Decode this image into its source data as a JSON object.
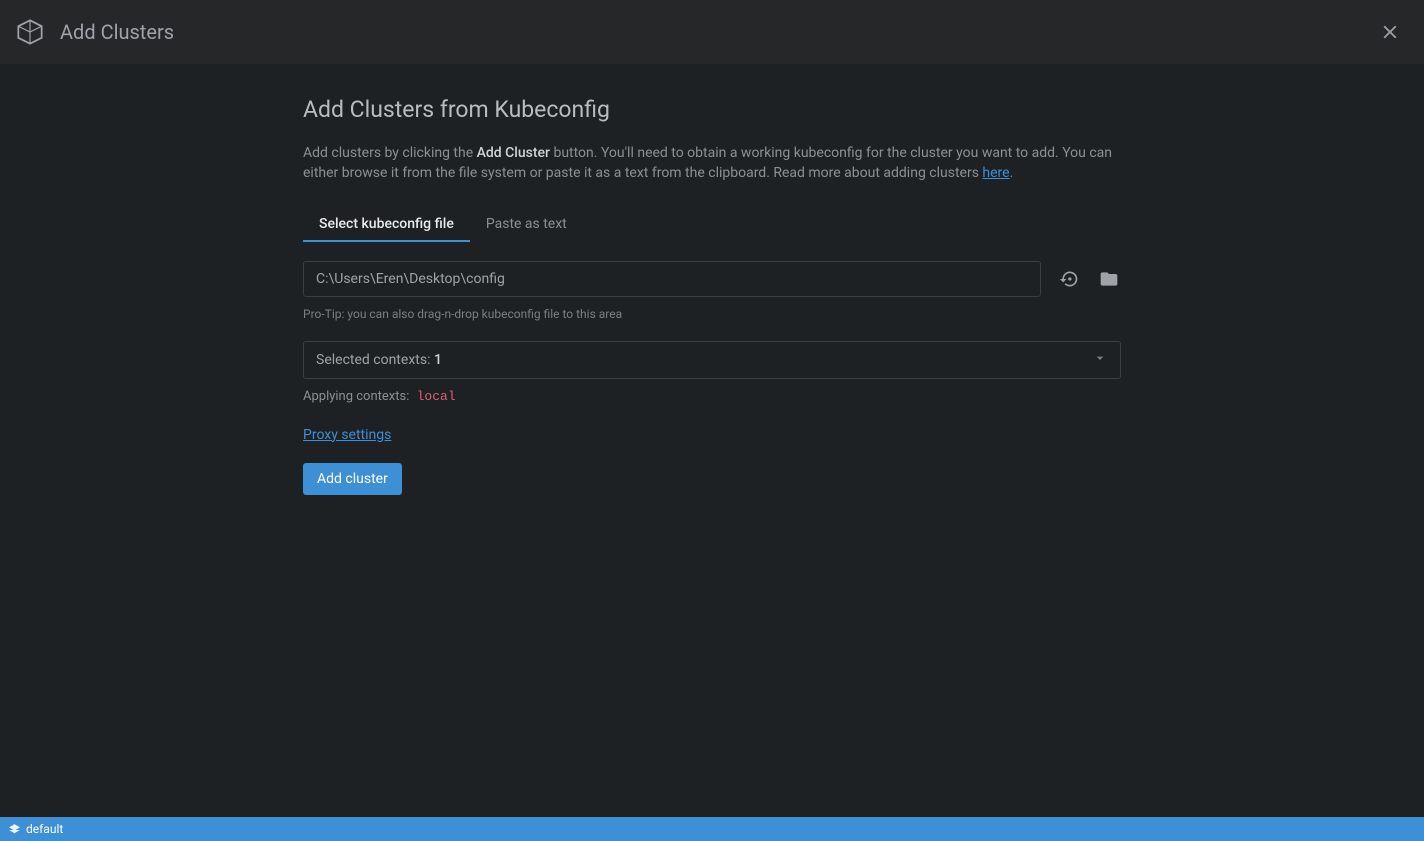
{
  "header": {
    "title": "Add Clusters"
  },
  "page": {
    "title": "Add Clusters from Kubeconfig",
    "description_pre": "Add clusters by clicking the ",
    "description_bold": "Add Cluster",
    "description_mid": " button. You'll need to obtain a working kubeconfig for the cluster you want to add. You can either browse it from the file system or paste it as a text from the clipboard. Read more about adding clusters ",
    "description_link": "here",
    "description_post": "."
  },
  "tabs": {
    "select_file": "Select kubeconfig file",
    "paste_text": "Paste as text"
  },
  "kubeconfig": {
    "path": "C:\\Users\\Eren\\Desktop\\config",
    "hint": "Pro-Tip: you can also drag-n-drop kubeconfig file to this area"
  },
  "contexts": {
    "label": "Selected contexts: ",
    "count": "1",
    "applying_label": "Applying contexts:",
    "applying_value": "local"
  },
  "links": {
    "proxy": "Proxy settings"
  },
  "buttons": {
    "add_cluster": "Add cluster"
  },
  "statusbar": {
    "text": "default"
  }
}
